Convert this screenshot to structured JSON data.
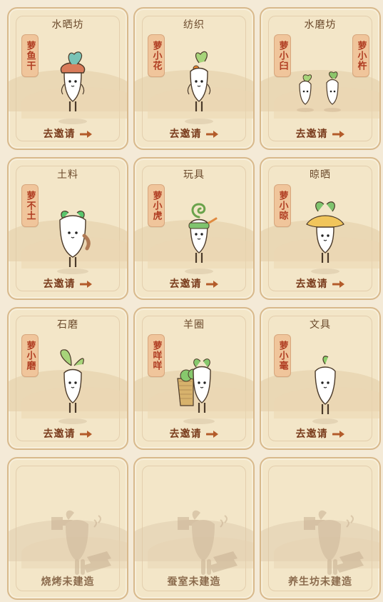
{
  "cards": [
    {
      "title": "水晒坊",
      "names": [
        "萝鱼干"
      ],
      "invite": "去邀请"
    },
    {
      "title": "纺织",
      "names": [
        "萝小花"
      ],
      "invite": "去邀请"
    },
    {
      "title": "水磨坊",
      "names": [
        "萝小臼",
        "萝小杵"
      ],
      "invite": "去邀请"
    },
    {
      "title": "土料",
      "names": [
        "萝不土"
      ],
      "invite": "去邀请"
    },
    {
      "title": "玩具",
      "names": [
        "萝小虎"
      ],
      "invite": "去邀请"
    },
    {
      "title": "晾晒",
      "names": [
        "萝小晾"
      ],
      "invite": "去邀请"
    },
    {
      "title": "石磨",
      "names": [
        "萝小磨"
      ],
      "invite": "去邀请"
    },
    {
      "title": "羊圈",
      "names": [
        "萝咩咩"
      ],
      "invite": "去邀请"
    },
    {
      "title": "文具",
      "names": [
        "萝小毫"
      ],
      "invite": "去邀请"
    },
    {
      "status": "烧烤未建造"
    },
    {
      "status": "蚕室未建造"
    },
    {
      "status": "养生坊未建造"
    }
  ],
  "colors": {
    "background": "#f4ead7",
    "card": "#f3e6c8",
    "border": "#d8b98c",
    "title": "#6b4a2c",
    "invite": "#7a3c1d",
    "nameplate_bg": "#f0c59b",
    "nameplate_text": "#b03d22"
  }
}
